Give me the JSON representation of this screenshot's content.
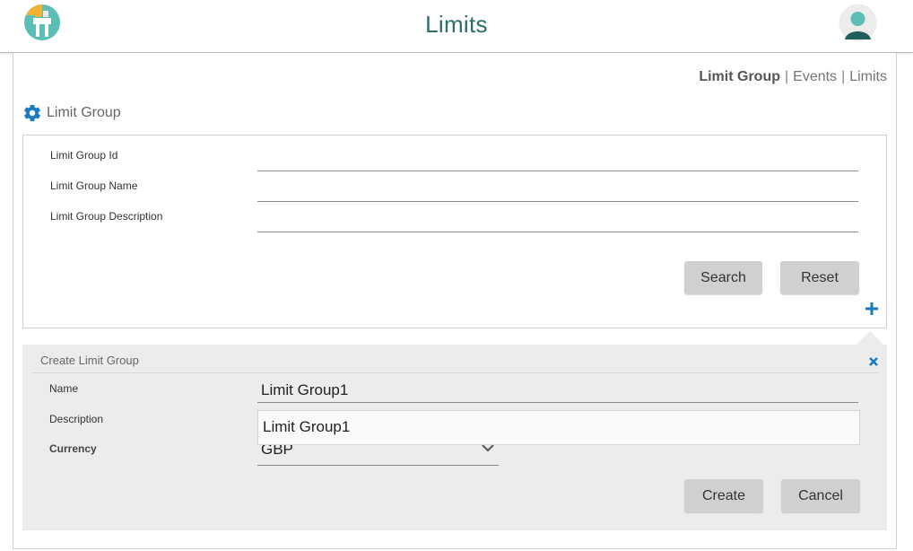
{
  "header": {
    "title": "Limits",
    "logo_icon": "app-logo-icon",
    "avatar_icon": "user-avatar-icon",
    "title_color": "#2a6f6a"
  },
  "nav": {
    "items": [
      {
        "label": "Limit Group",
        "active": true
      },
      {
        "label": "Events",
        "active": false
      },
      {
        "label": "Limits",
        "active": false
      }
    ],
    "separator": "|"
  },
  "search_section": {
    "title": "Limit Group",
    "icon": "gear-icon",
    "fields": [
      {
        "label": "Limit Group Id",
        "value": ""
      },
      {
        "label": "Limit Group Name",
        "value": ""
      },
      {
        "label": "Limit Group Description",
        "value": ""
      }
    ],
    "search_label": "Search",
    "reset_label": "Reset",
    "add_icon": "plus-icon",
    "accent": "#1a7bbf"
  },
  "create_panel": {
    "title": "Create Limit Group",
    "close_icon": "close-icon",
    "name_label": "Name",
    "name_value": "Limit Group1",
    "description_label": "Description",
    "description_value": "Limit Group1",
    "currency_label": "Currency",
    "currency_value": "GBP",
    "create_label": "Create",
    "cancel_label": "Cancel"
  }
}
